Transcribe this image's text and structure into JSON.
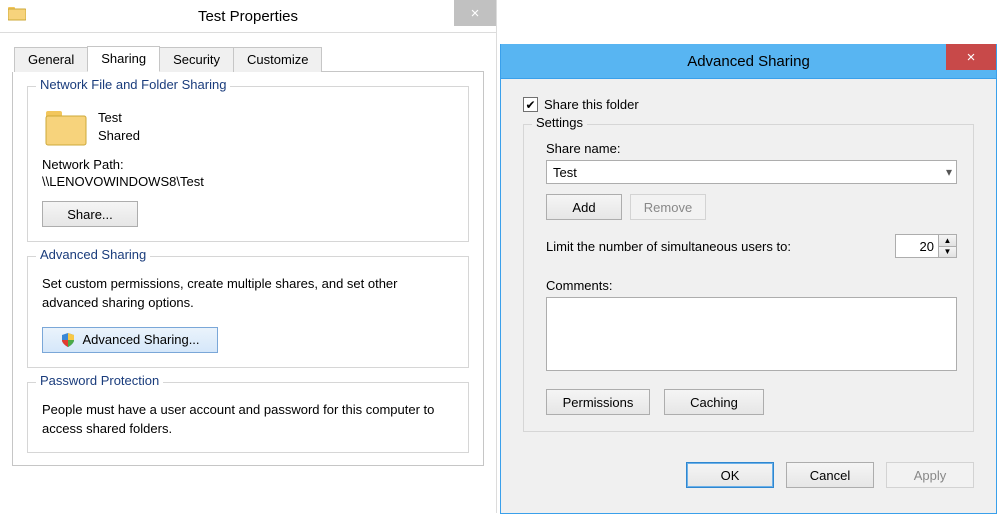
{
  "properties": {
    "title": "Test Properties",
    "tabs": {
      "general": "General",
      "sharing": "Sharing",
      "security": "Security",
      "customize": "Customize"
    },
    "nfs": {
      "group_title": "Network File and Folder Sharing",
      "name": "Test",
      "status": "Shared",
      "path_label": "Network Path:",
      "path_value": "\\\\LENOVOWINDOWS8\\Test",
      "share_btn": "Share..."
    },
    "adv": {
      "group_title": "Advanced Sharing",
      "desc": "Set custom permissions, create multiple shares, and set other advanced sharing options.",
      "btn": "Advanced Sharing..."
    },
    "pw": {
      "group_title": "Password Protection",
      "desc": "People must have a user account and password for this computer to access shared folders."
    }
  },
  "advdlg": {
    "title": "Advanced Sharing",
    "share_this_folder": "Share this folder",
    "settings_title": "Settings",
    "share_name_label": "Share name:",
    "share_name_value": "Test",
    "add_btn": "Add",
    "remove_btn": "Remove",
    "limit_label": "Limit the number of simultaneous users to:",
    "limit_value": "20",
    "comments_label": "Comments:",
    "permissions_btn": "Permissions",
    "caching_btn": "Caching",
    "ok_btn": "OK",
    "cancel_btn": "Cancel",
    "apply_btn": "Apply"
  }
}
